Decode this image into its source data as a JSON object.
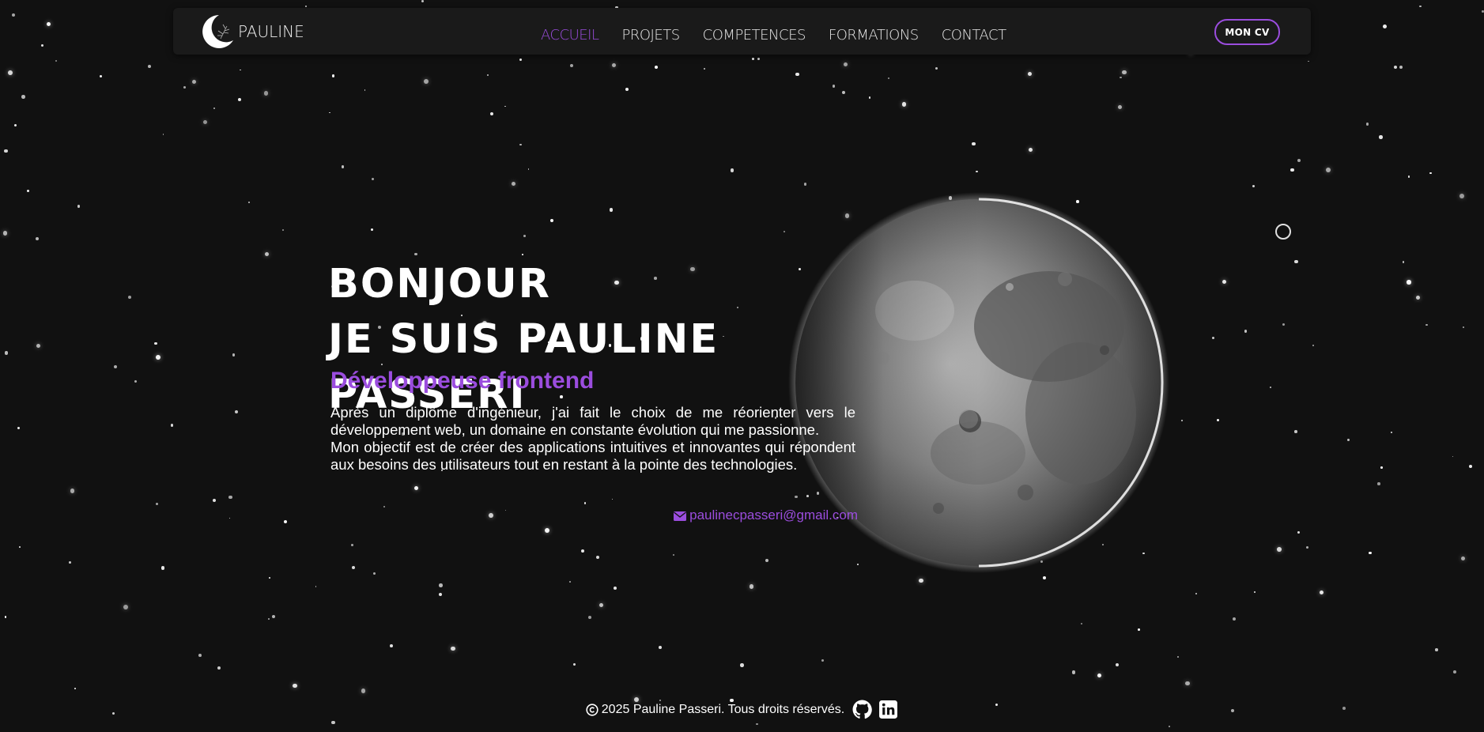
{
  "brand": {
    "name": "PAULINE"
  },
  "nav": {
    "links": [
      {
        "label": "ACCUEIL",
        "active": true
      },
      {
        "label": "PROJETS",
        "active": false
      },
      {
        "label": "COMPETENCES",
        "active": false
      },
      {
        "label": "FORMATIONS",
        "active": false
      },
      {
        "label": "CONTACT",
        "active": false
      }
    ],
    "cv_button": "MON CV"
  },
  "hero": {
    "line1": "BONJOUR",
    "line2": "JE SUIS PAULINE PASSERI",
    "role": "Développeuse frontend",
    "bio_p1": "Après un diplôme d'ingénieur, j'ai fait le choix de me réorienter vers le développement web, un domaine en constante évolution qui me passionne.",
    "bio_p2": "Mon objectif est de créer des applications intuitives et innovantes qui répondent aux besoins des utilisateurs tout en restant à la pointe des technologies.",
    "email": "paulinecpasseri@gmail.com"
  },
  "footer": {
    "copyright": "2025 Pauline Passeri. Tous droits réservés.",
    "social": [
      "github-icon",
      "linkedin-icon"
    ]
  },
  "colors": {
    "background": "#111111",
    "accent": "#9b4dde",
    "navbar": "#1a1a1a",
    "text": "#ffffff"
  }
}
